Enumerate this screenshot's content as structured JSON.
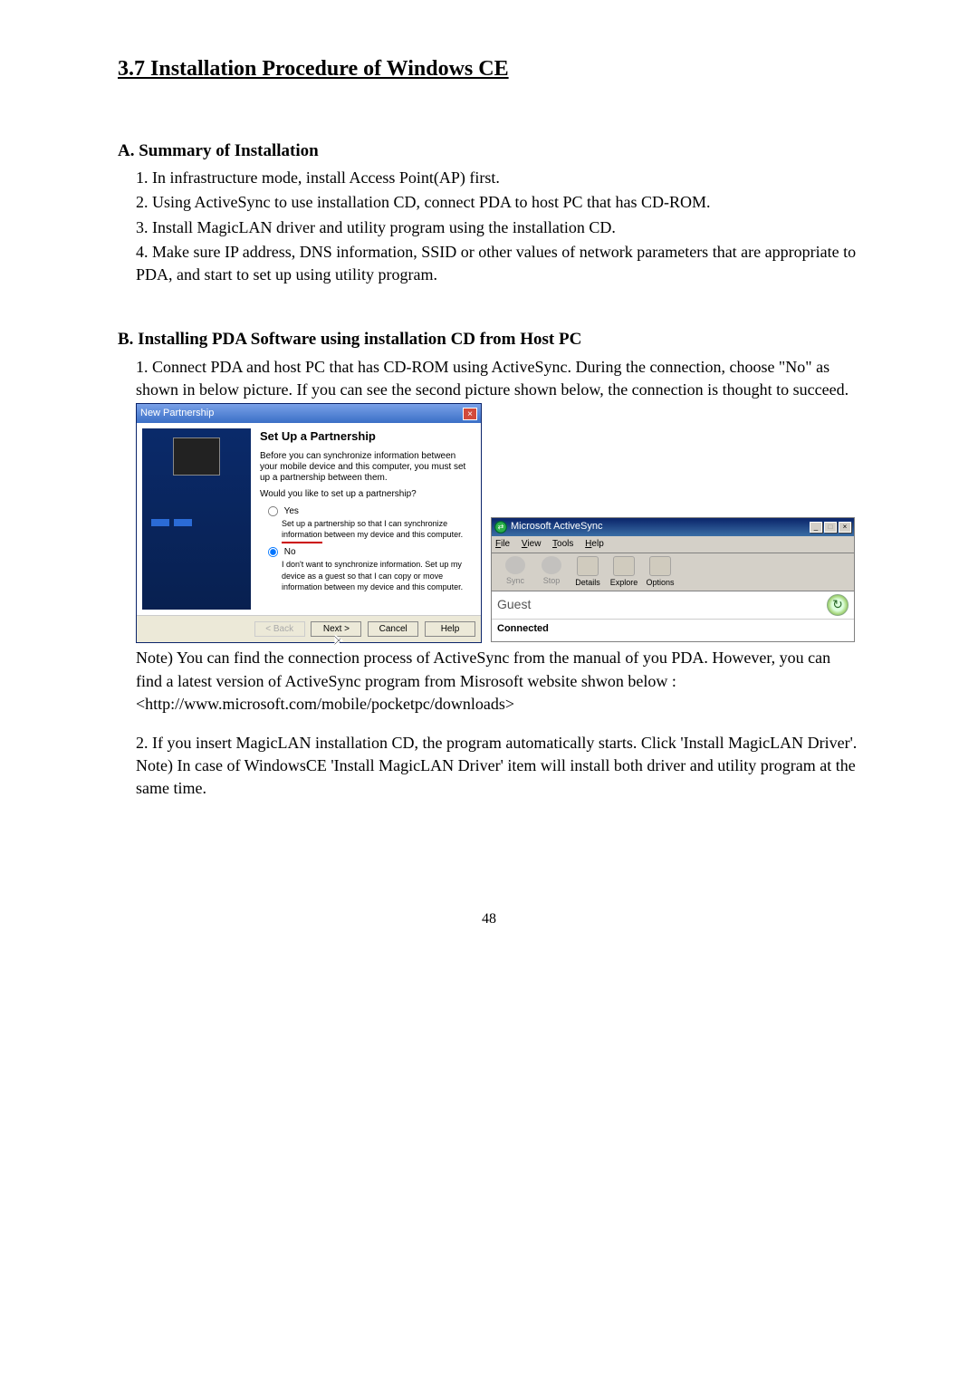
{
  "heading": "3.7 Installation Procedure of Windows CE",
  "sectionA": {
    "title": "A. Summary of Installation",
    "items": [
      "1. In infrastructure mode, install Access Point(AP) first.",
      "2. Using ActiveSync to use installation CD, connect PDA to host PC that has CD-ROM.",
      "3. Install MagicLAN driver and utility program using the installation CD.",
      "4. Make sure IP address, DNS information, SSID or other values of network parameters that are appropriate to PDA, and start to set up using utility program."
    ]
  },
  "sectionB": {
    "title": "B. Installing PDA Software using installation CD from Host PC",
    "para1": "1. Connect PDA and host PC that has CD-ROM using ActiveSync. During the connection, choose \"No\" as shown in below picture. If you can see the second picture shown below, the connection is thought to succeed."
  },
  "dlg1": {
    "title": "New Partnership",
    "h": "Set Up a Partnership",
    "p1": "Before you can synchronize information between your mobile device and this computer, you must set up a partnership between them.",
    "p2": "Would you like to set up a partnership?",
    "yes": "Yes",
    "yesDesc": "Set up a partnership so that I can synchronize information between my device and this computer.",
    "no": "No",
    "noDesc": "I don't want to synchronize information. Set up my device as a guest so that I can copy or move information between my device and this computer.",
    "back": "< Back",
    "next": "Next >",
    "cancel": "Cancel",
    "help": "Help"
  },
  "dlg2": {
    "title": "Microsoft ActiveSync",
    "menu": {
      "file": "File",
      "view": "View",
      "tools": "Tools",
      "help": "Help"
    },
    "tool": {
      "sync": "Sync",
      "stop": "Stop",
      "details": "Details",
      "explore": "Explore",
      "options": "Options"
    },
    "guest": "Guest",
    "connected": "Connected"
  },
  "afterShots": {
    "note1": "Note) You can find the connection process of ActiveSync from the manual of you PDA. However, you can find a latest version of ActiveSync program from Misrosoft website shwon below :",
    "url": "<http://www.microsoft.com/mobile/pocketpc/downloads>",
    "p2a": "2. If you insert MagicLAN installation CD, the program automatically starts. Click 'Install MagicLAN Driver'.",
    "note2": "Note) In case of WindowsCE 'Install MagicLAN Driver' item will install both driver and utility program at the same time."
  },
  "pageNumber": "48"
}
